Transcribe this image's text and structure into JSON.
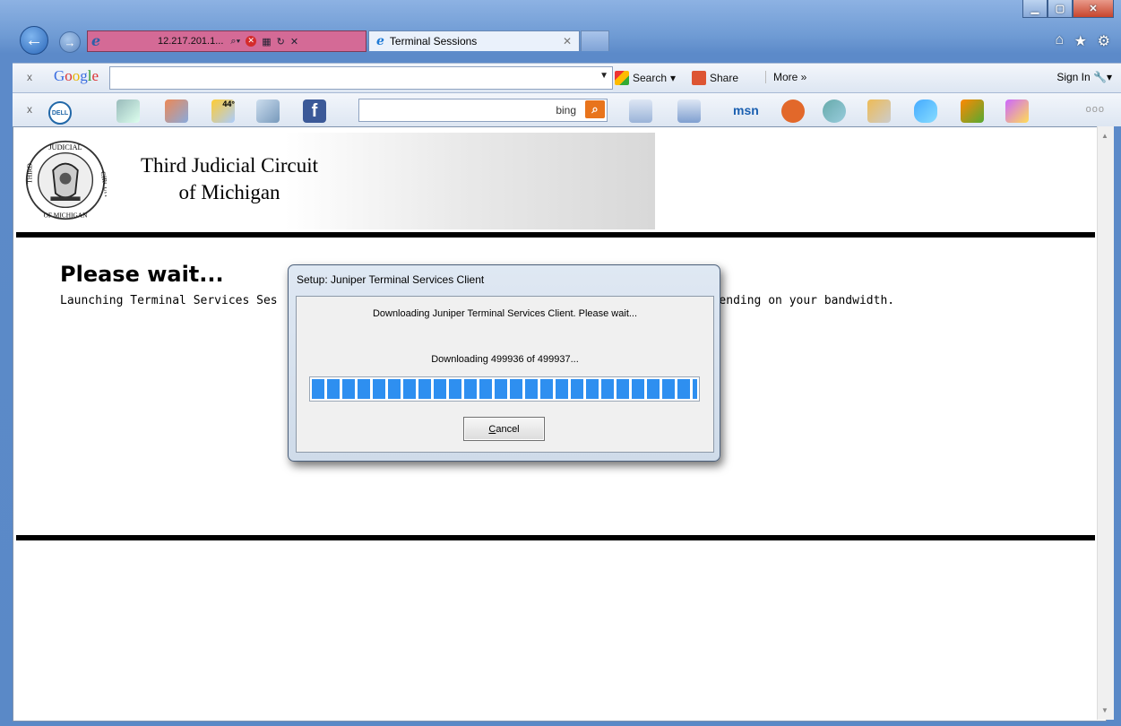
{
  "browser": {
    "address_text": "12.217.201.1...",
    "tab_title": "Terminal Sessions",
    "google_bar": {
      "search_label": "Search",
      "share_label": "Share",
      "more_label": "More »",
      "sign_in_label": "Sign In"
    },
    "bing_bar": {
      "bing_label": "bing",
      "weather_temp": "44°",
      "msn_label": "msn"
    }
  },
  "page": {
    "court_line1": "Third Judicial Circuit",
    "court_line2": "of Michigan",
    "seal_top_text": "JUDICIAL",
    "seal_left_text": "THIRD",
    "seal_right_text": "CIRCUIT",
    "seal_bottom_text": "OF MICHIGAN",
    "wait_title": "Please wait...",
    "wait_text_left": "Launching Terminal Services Ses",
    "wait_text_right": "es, depending on your bandwidth."
  },
  "dialog": {
    "title": "Setup: Juniper Terminal Services Client",
    "message": "Downloading Juniper Terminal Services Client. Please wait...",
    "progress_text": "Downloading 499936 of 499937...",
    "progress_fraction": 0.99999,
    "cancel_label": "Cancel"
  },
  "colors": {
    "progress_fill": "#2e8ff0",
    "address_bar_bg": "#d46a96"
  }
}
